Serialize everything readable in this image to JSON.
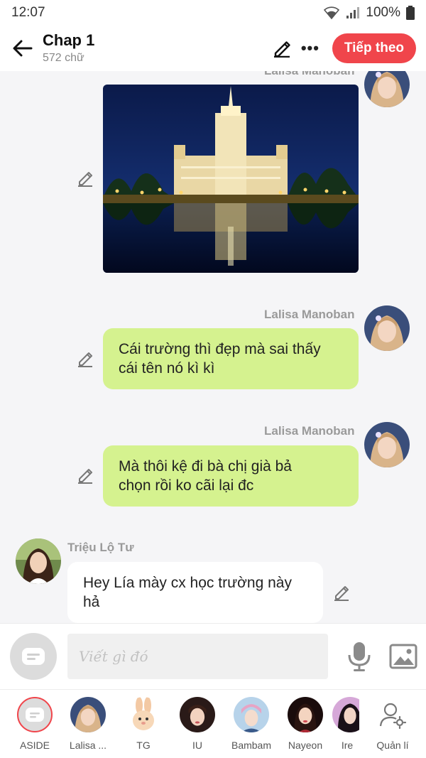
{
  "status_bar": {
    "time": "12:07",
    "battery": "100%",
    "icons": [
      "wifi-icon",
      "signal-icon",
      "battery-icon"
    ]
  },
  "header": {
    "title": "Chap 1",
    "subtitle": "572 chữ",
    "next_label": "Tiếp theo",
    "more_label": "•••",
    "accent_color": "#f0454b"
  },
  "chat": {
    "partial_top_name": "Lalisa Manoban",
    "messages": [
      {
        "sender": "Lalisa Manoban",
        "type": "image",
        "image_desc": "night-building-photo"
      },
      {
        "sender": "Lalisa Manoban",
        "type": "text",
        "line1": "Cái trường thì đẹp mà sai thấy",
        "line2": "cái tên nó kì kì"
      },
      {
        "sender": "Lalisa Manoban",
        "type": "text",
        "line1": "Mà thôi kệ đi bà chị già bả",
        "line2": "chọn rồi ko cãi lại đc"
      },
      {
        "sender": "Triệu Lộ Tư",
        "type": "text",
        "line1": "Hey Lía mày cx học trường này",
        "line2": "hả"
      }
    ],
    "bubble_color_own": "#d5f28f",
    "bubble_color_other": "#ffffff"
  },
  "composer": {
    "placeholder": "Viết gì đó"
  },
  "characters": [
    {
      "label": "ASIDE"
    },
    {
      "label": "Lalisa ..."
    },
    {
      "label": "TG"
    },
    {
      "label": "IU"
    },
    {
      "label": "Bambam"
    },
    {
      "label": "Nayeon"
    },
    {
      "label": "Ire"
    },
    {
      "label": "Quản lí"
    }
  ]
}
